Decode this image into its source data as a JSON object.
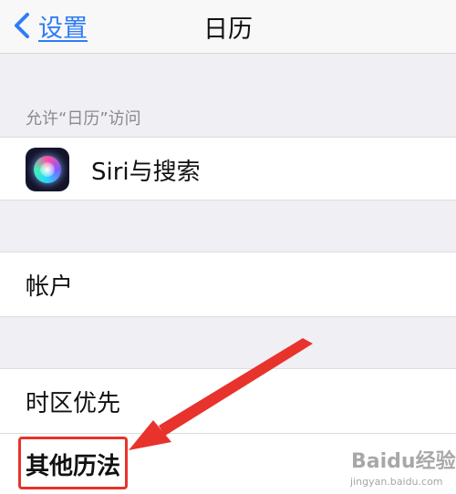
{
  "nav": {
    "back_label": "设置",
    "title": "日历"
  },
  "group": {
    "header": "允许“日历”访问"
  },
  "cells": {
    "siri": "Siri与搜索",
    "account": "帐户",
    "timezone": "时区优先",
    "other": "其他历法"
  },
  "watermark": {
    "text": "Baidu经验",
    "sub": "jingyan.baidu.com"
  },
  "colors": {
    "accent": "#2f7cf6",
    "annotation": "#e8322c"
  }
}
